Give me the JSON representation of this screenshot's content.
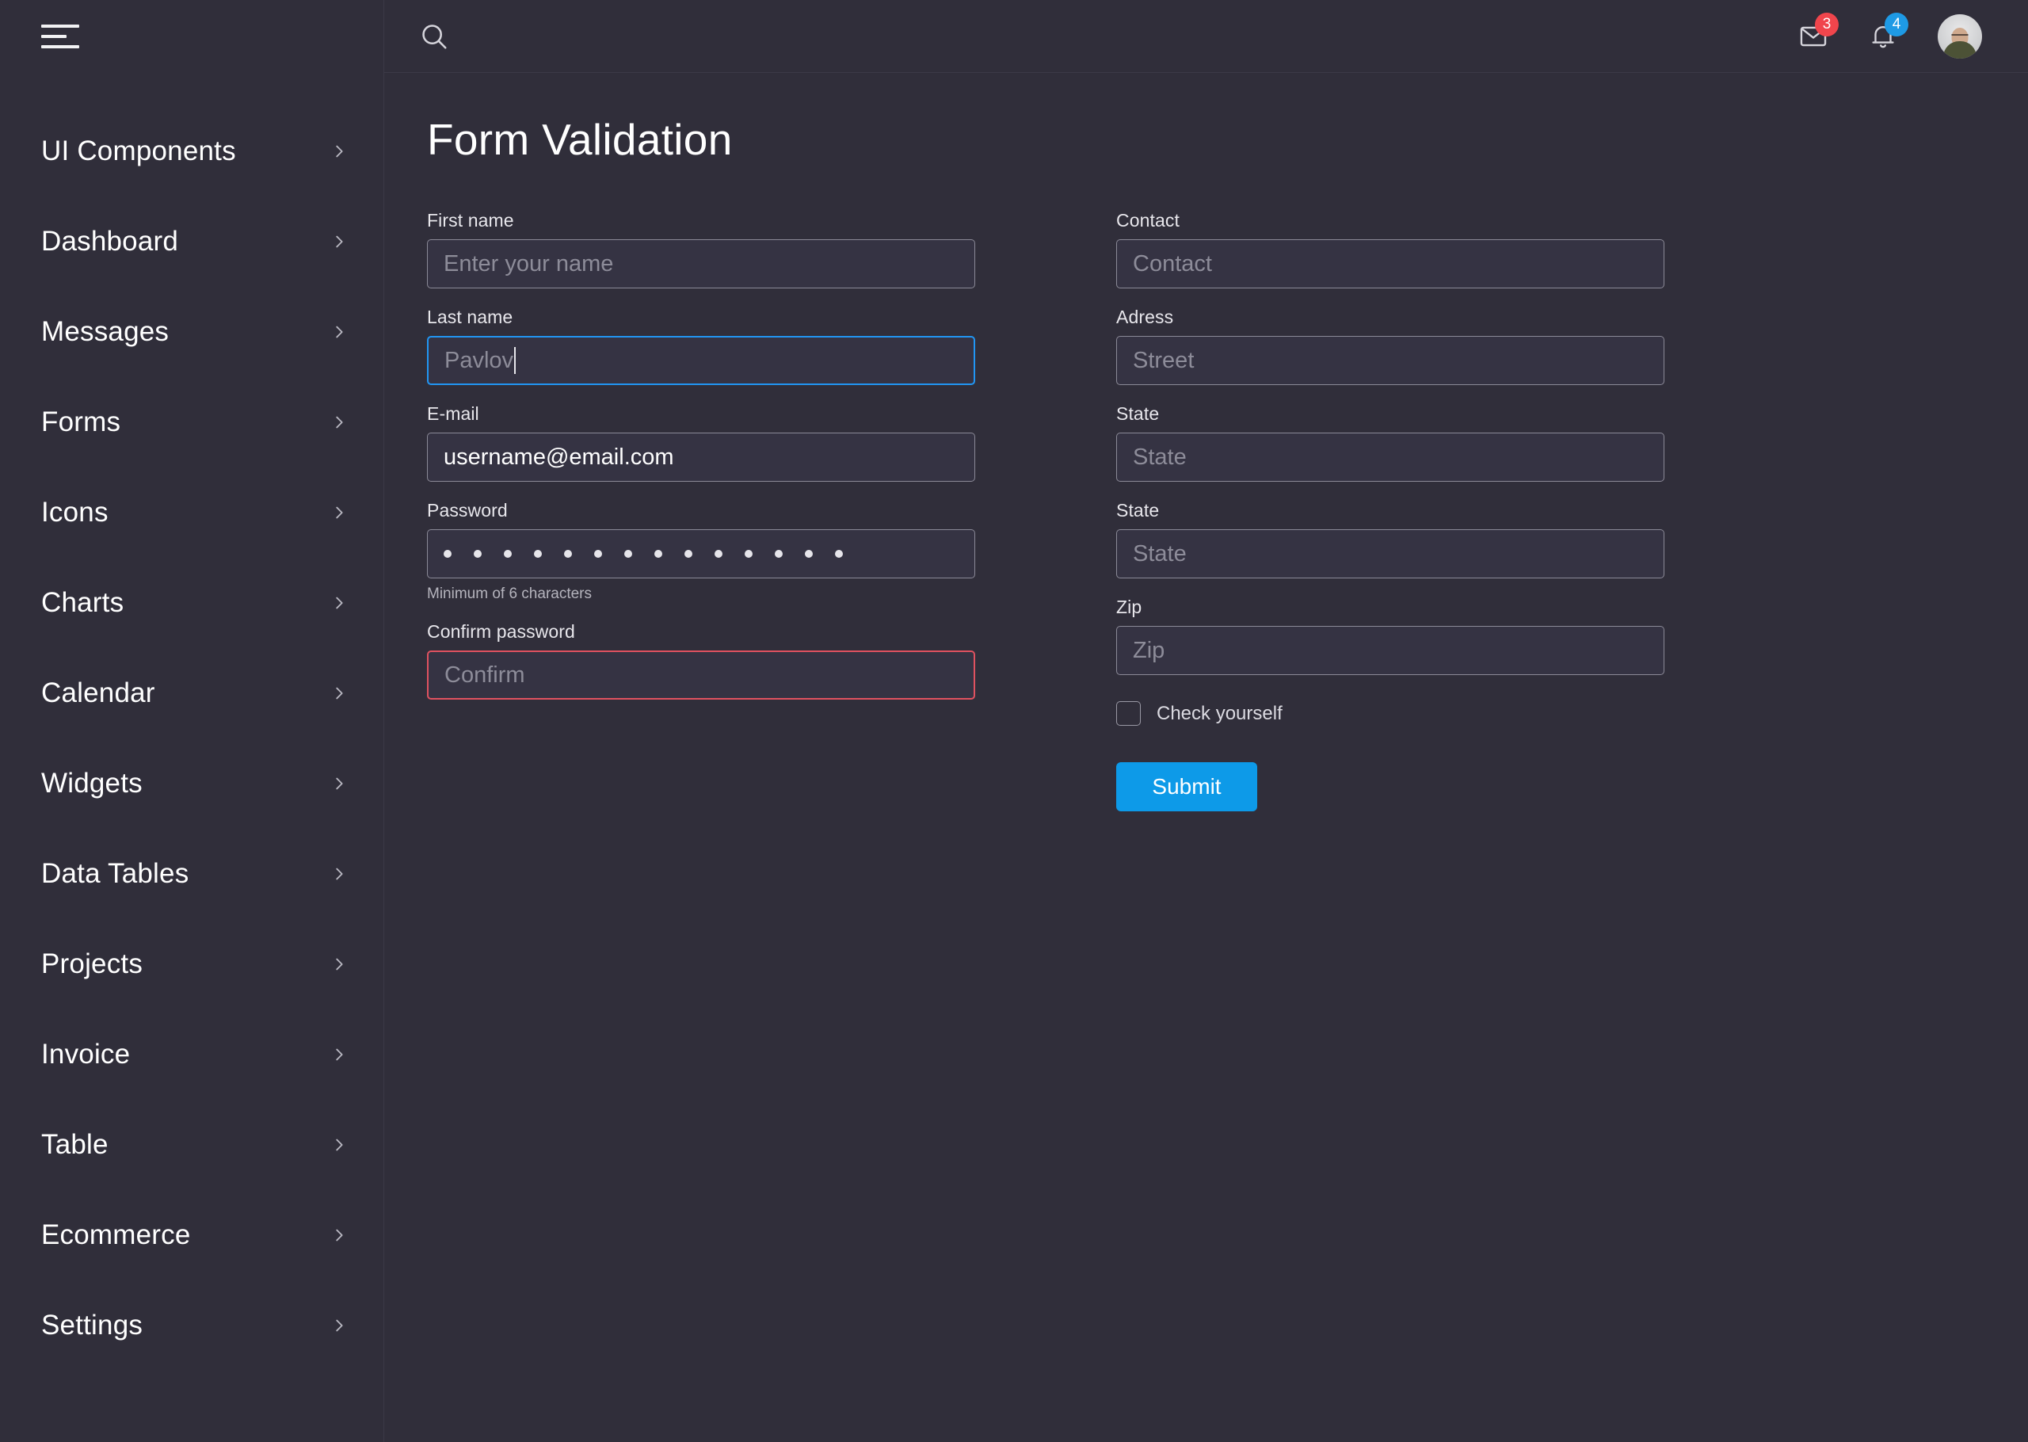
{
  "theme": {
    "sidebar_bg": "#302e3a",
    "content_bg": "#302e3a",
    "accent_blue": "#0d9ae8",
    "focus_blue": "#2196f3",
    "error_red": "#e05260",
    "badge_red": "#f0454c",
    "badge_blue": "#1e9ae5",
    "text_primary": "#ffffff",
    "placeholder": "#8d8c99"
  },
  "sidebar": {
    "menu_icon": "hamburger-icon",
    "items": [
      {
        "label": "UI Components",
        "chevron": "chevron-right-icon"
      },
      {
        "label": "Dashboard",
        "chevron": "chevron-right-icon"
      },
      {
        "label": "Messages",
        "chevron": "chevron-right-icon"
      },
      {
        "label": "Forms",
        "chevron": "chevron-right-icon"
      },
      {
        "label": "Icons",
        "chevron": "chevron-right-icon"
      },
      {
        "label": "Charts",
        "chevron": "chevron-right-icon"
      },
      {
        "label": "Calendar",
        "chevron": "chevron-right-icon"
      },
      {
        "label": "Widgets",
        "chevron": "chevron-right-icon"
      },
      {
        "label": "Data Tables",
        "chevron": "chevron-right-icon"
      },
      {
        "label": "Projects",
        "chevron": "chevron-right-icon"
      },
      {
        "label": "Invoice",
        "chevron": "chevron-right-icon"
      },
      {
        "label": "Table",
        "chevron": "chevron-right-icon"
      },
      {
        "label": "Ecommerce",
        "chevron": "chevron-right-icon"
      },
      {
        "label": "Settings",
        "chevron": "chevron-right-icon"
      }
    ]
  },
  "topbar": {
    "search_icon": "search-icon",
    "mail_icon": "mail-icon",
    "mail_badge": "3",
    "bell_icon": "bell-icon",
    "bell_badge": "4",
    "avatar": "user-avatar"
  },
  "page": {
    "title": "Form Validation"
  },
  "form": {
    "left": {
      "first_name": {
        "label": "First name",
        "placeholder": "Enter your name",
        "value": ""
      },
      "last_name": {
        "label": "Last name",
        "placeholder": "Pavlov",
        "value": "",
        "state": "focused"
      },
      "email": {
        "label": "E-mail",
        "placeholder": "",
        "value": "username@email.com"
      },
      "password": {
        "label": "Password",
        "placeholder": "",
        "masked_length": 14,
        "help": "Minimum of 6 characters"
      },
      "confirm_password": {
        "label": "Confirm password",
        "placeholder": "Confirm",
        "value": "",
        "state": "error"
      }
    },
    "right": {
      "contact": {
        "label": "Contact",
        "placeholder": "Contact",
        "value": ""
      },
      "adress": {
        "label": "Adress",
        "placeholder": "Street",
        "value": ""
      },
      "state1": {
        "label": "State",
        "placeholder": "State",
        "value": ""
      },
      "state2": {
        "label": "State",
        "placeholder": "State",
        "value": ""
      },
      "zip": {
        "label": "Zip",
        "placeholder": "Zip",
        "value": ""
      },
      "checkbox": {
        "label": "Check yourself",
        "checked": false
      },
      "submit": {
        "label": "Submit"
      }
    }
  }
}
